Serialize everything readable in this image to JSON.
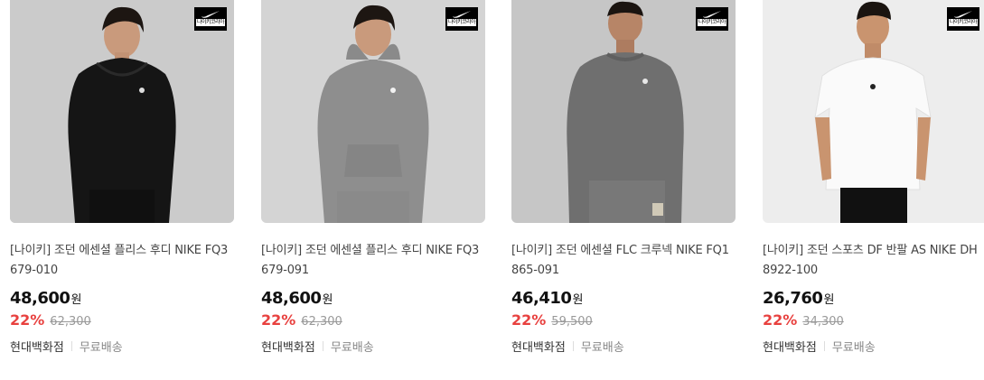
{
  "products": [
    {
      "title": "[나이키] 조던 에센셜 플리스 후디 NIKE FQ3679-010",
      "price": "48,600",
      "currency": "원",
      "discount": "22%",
      "original_price": "62,300",
      "seller": "현대백화점",
      "shipping": "무료배송",
      "badge_text": "나이키코리아",
      "image_bg": "#cfcfcf",
      "garment_color": "#151515"
    },
    {
      "title": "[나이키] 조던 에센셜 플리스 후디 NIKE FQ3679-091",
      "price": "48,600",
      "currency": "원",
      "discount": "22%",
      "original_price": "62,300",
      "seller": "현대백화점",
      "shipping": "무료배송",
      "badge_text": "나이키코리아",
      "image_bg": "#d6d6d6",
      "garment_color": "#8e8e8e"
    },
    {
      "title": "[나이키] 조던 에센셜 FLC 크루넥 NIKE FQ1865-091",
      "price": "46,410",
      "currency": "원",
      "discount": "22%",
      "original_price": "59,500",
      "seller": "현대백화점",
      "shipping": "무료배송",
      "badge_text": "나이키코리아",
      "image_bg": "#c8c8c8",
      "garment_color": "#6f6f6f"
    },
    {
      "title": "[나이키] 조던 스포츠 DF 반팔 AS NIKE DH8922-100",
      "price": "26,760",
      "currency": "원",
      "discount": "22%",
      "original_price": "34,300",
      "seller": "현대백화점",
      "shipping": "무료배송",
      "badge_text": "나이키코리아",
      "image_bg": "#ececec",
      "garment_color": "#fafafa"
    }
  ]
}
